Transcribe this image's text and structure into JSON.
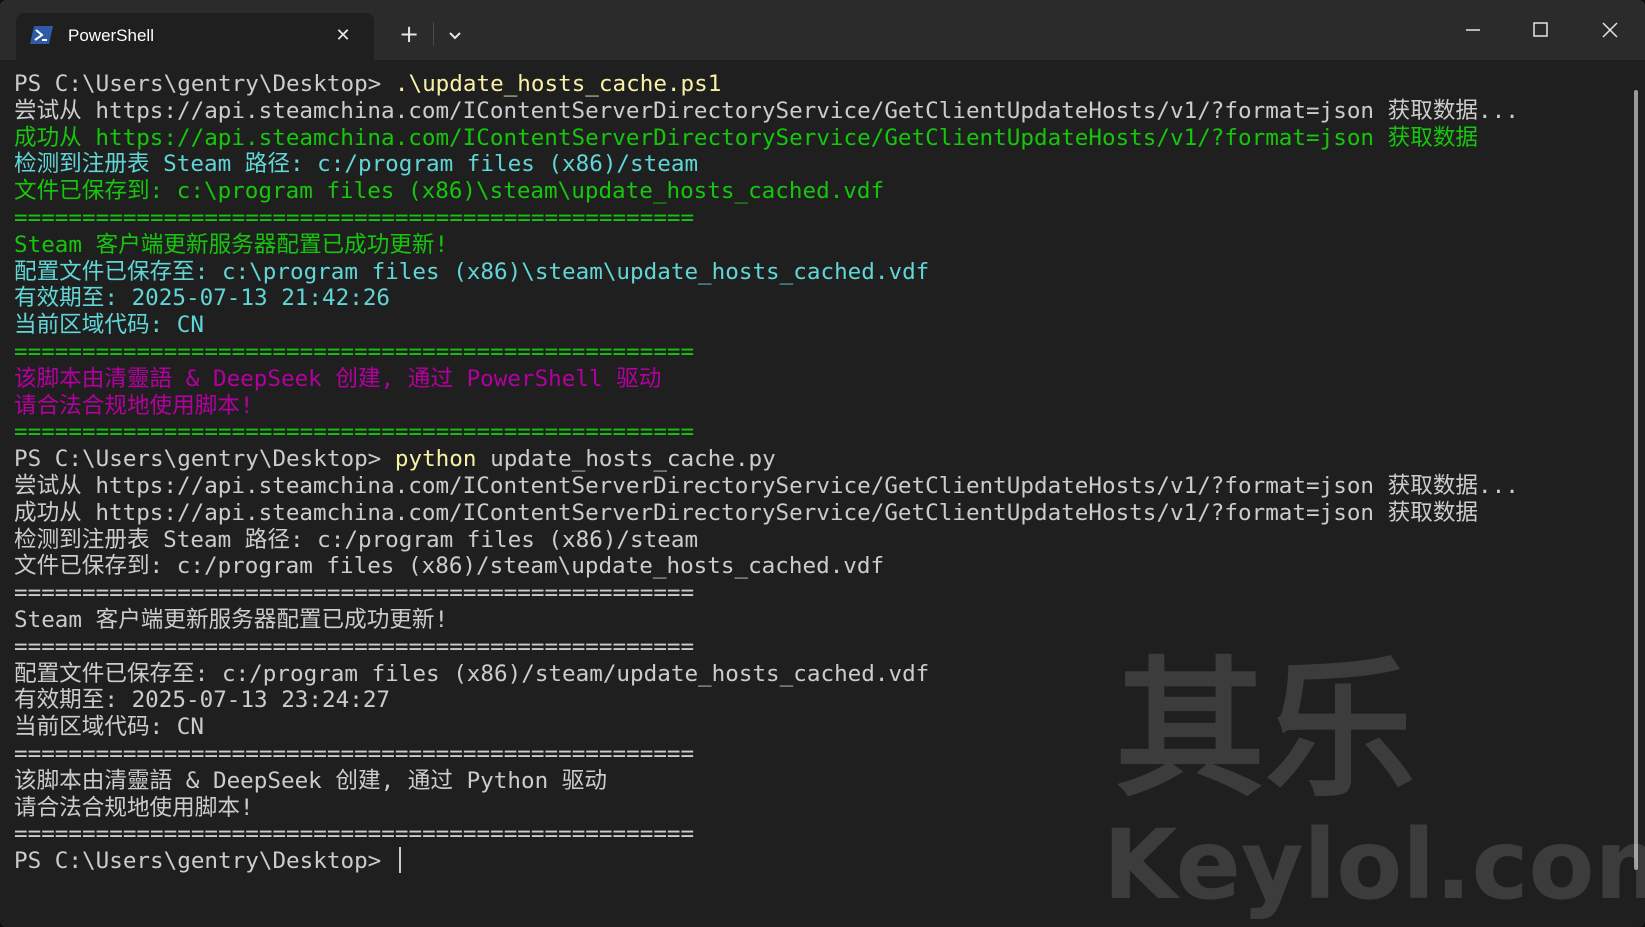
{
  "window": {
    "tab_title": "PowerShell",
    "tab_icon": "powershell-icon",
    "new_tab_label": "+",
    "close_tab_icon": "close-icon",
    "dropdown_icon": "chevron-down-icon",
    "controls": [
      "minimize-icon",
      "maximize-icon",
      "close-icon"
    ]
  },
  "terminal": {
    "colors": {
      "gray": "#cccccc",
      "green": "#16c60c",
      "cyan": "#61d6d6",
      "magenta": "#b4009e",
      "yellow": "#f9f1a5",
      "background": "#1f1f1f"
    },
    "lines": [
      {
        "segments": [
          {
            "text": "PS C:\\Users\\gentry\\Desktop> ",
            "color": "gray"
          },
          {
            "text": ".\\update_hosts_cache.ps1",
            "color": "yellow"
          }
        ]
      },
      {
        "segments": [
          {
            "text": "尝试从 https://api.steamchina.com/IContentServerDirectoryService/GetClientUpdateHosts/v1/?format=json 获取数据...",
            "color": "gray"
          }
        ]
      },
      {
        "segments": [
          {
            "text": "成功从 https://api.steamchina.com/IContentServerDirectoryService/GetClientUpdateHosts/v1/?format=json 获取数据",
            "color": "green"
          }
        ]
      },
      {
        "segments": [
          {
            "text": "检测到注册表 Steam 路径: c:/program files (x86)/steam",
            "color": "cyan"
          }
        ]
      },
      {
        "segments": [
          {
            "text": "文件已保存到: c:\\program files (x86)\\steam\\update_hosts_cached.vdf",
            "color": "green"
          }
        ]
      },
      {
        "segments": [
          {
            "text": "==================================================",
            "color": "green"
          }
        ]
      },
      {
        "segments": [
          {
            "text": "Steam 客户端更新服务器配置已成功更新!",
            "color": "green"
          }
        ]
      },
      {
        "segments": [
          {
            "text": "配置文件已保存至: c:\\program files (x86)\\steam\\update_hosts_cached.vdf",
            "color": "cyan"
          }
        ]
      },
      {
        "segments": [
          {
            "text": "有效期至: 2025-07-13 21:42:26",
            "color": "cyan"
          }
        ]
      },
      {
        "segments": [
          {
            "text": "当前区域代码: CN",
            "color": "cyan"
          }
        ]
      },
      {
        "segments": [
          {
            "text": "==================================================",
            "color": "green"
          }
        ]
      },
      {
        "segments": [
          {
            "text": "该脚本由清靈語 & DeepSeek 创建, 通过 PowerShell 驱动",
            "color": "magenta"
          }
        ]
      },
      {
        "segments": [
          {
            "text": "请合法合规地使用脚本!",
            "color": "magenta"
          }
        ]
      },
      {
        "segments": [
          {
            "text": "==================================================",
            "color": "green"
          }
        ]
      },
      {
        "segments": [
          {
            "text": "PS C:\\Users\\gentry\\Desktop> ",
            "color": "gray"
          },
          {
            "text": "python",
            "color": "yellow"
          },
          {
            "text": " update_hosts_cache.py",
            "color": "gray"
          }
        ]
      },
      {
        "segments": [
          {
            "text": "尝试从 https://api.steamchina.com/IContentServerDirectoryService/GetClientUpdateHosts/v1/?format=json 获取数据...",
            "color": "gray"
          }
        ]
      },
      {
        "segments": [
          {
            "text": "成功从 https://api.steamchina.com/IContentServerDirectoryService/GetClientUpdateHosts/v1/?format=json 获取数据",
            "color": "gray"
          }
        ]
      },
      {
        "segments": [
          {
            "text": "检测到注册表 Steam 路径: c:/program files (x86)/steam",
            "color": "gray"
          }
        ]
      },
      {
        "segments": [
          {
            "text": "文件已保存到: c:/program files (x86)/steam\\update_hosts_cached.vdf",
            "color": "gray"
          }
        ]
      },
      {
        "segments": [
          {
            "text": "==================================================",
            "color": "gray"
          }
        ]
      },
      {
        "segments": [
          {
            "text": "Steam 客户端更新服务器配置已成功更新!",
            "color": "gray"
          }
        ]
      },
      {
        "segments": [
          {
            "text": "==================================================",
            "color": "gray"
          }
        ]
      },
      {
        "segments": [
          {
            "text": "配置文件已保存至: c:/program files (x86)/steam/update_hosts_cached.vdf",
            "color": "gray"
          }
        ]
      },
      {
        "segments": [
          {
            "text": "有效期至: 2025-07-13 23:24:27",
            "color": "gray"
          }
        ]
      },
      {
        "segments": [
          {
            "text": "当前区域代码: CN",
            "color": "gray"
          }
        ]
      },
      {
        "segments": [
          {
            "text": "==================================================",
            "color": "gray"
          }
        ]
      },
      {
        "segments": [
          {
            "text": "该脚本由清靈語 & DeepSeek 创建, 通过 Python 驱动",
            "color": "gray"
          }
        ]
      },
      {
        "segments": [
          {
            "text": "请合法合规地使用脚本!",
            "color": "gray"
          }
        ]
      },
      {
        "segments": [
          {
            "text": "==================================================",
            "color": "gray"
          }
        ]
      }
    ],
    "prompt": "PS C:\\Users\\gentry\\Desktop> "
  },
  "watermark": {
    "cn": "其乐",
    "en": "Keylol.com"
  }
}
